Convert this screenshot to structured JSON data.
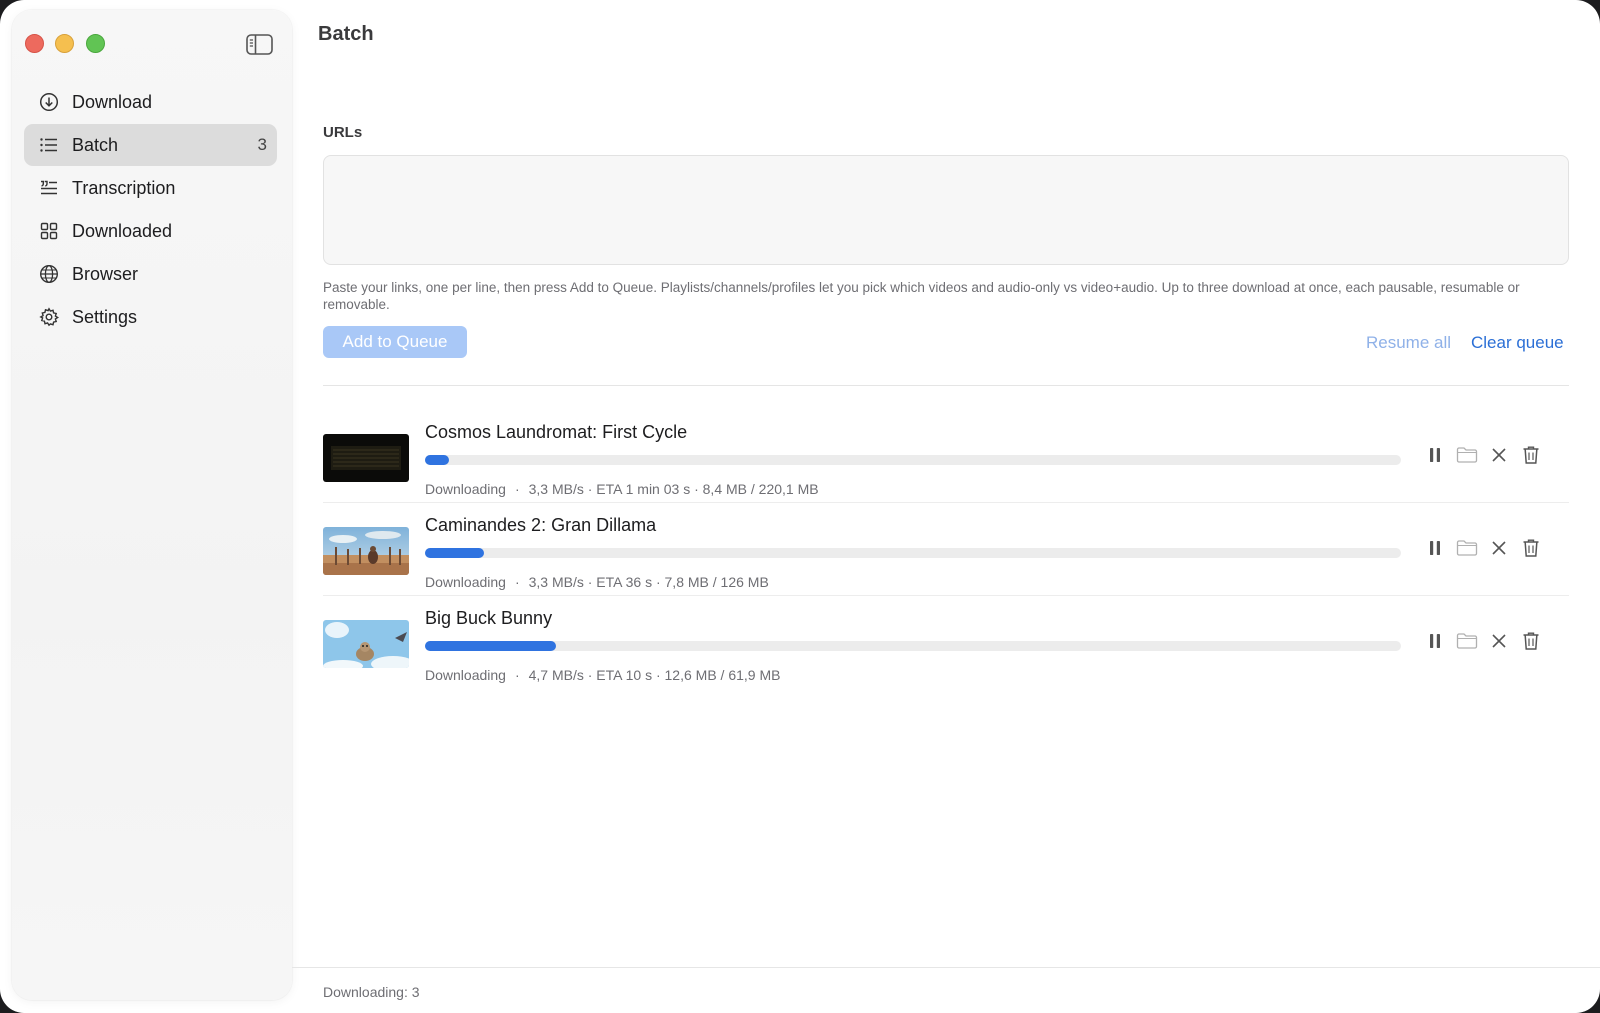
{
  "page": {
    "title": "Batch"
  },
  "sidebar": {
    "items": [
      {
        "label": "Download",
        "icon": "download-circle-icon"
      },
      {
        "label": "Batch",
        "icon": "list-icon",
        "badge": "3",
        "active": true
      },
      {
        "label": "Transcription",
        "icon": "transcription-icon"
      },
      {
        "label": "Downloaded",
        "icon": "grid-icon"
      },
      {
        "label": "Browser",
        "icon": "globe-icon"
      },
      {
        "label": "Settings",
        "icon": "gear-icon"
      }
    ]
  },
  "urls": {
    "label": "URLs",
    "value": "",
    "help": "Paste your links, one per line, then press Add to Queue. Playlists/channels/profiles let you pick which videos and audio-only vs video+audio. Up to three download at once, each pausable, resumable or removable."
  },
  "toolbar": {
    "add_label": "Add to Queue",
    "resume_all_label": "Resume all",
    "clear_queue_label": "Clear queue"
  },
  "queue": [
    {
      "title": "Cosmos Laundromat: First Cycle",
      "status": "Downloading",
      "details": "3,3 MB/s · ETA 1 min 03 s · 8,4 MB / 220,1 MB",
      "progress": 0.025
    },
    {
      "title": "Caminandes 2: Gran Dillama",
      "status": "Downloading",
      "details": "3,3 MB/s · ETA 36 s · 7,8 MB / 126 MB",
      "progress": 0.06
    },
    {
      "title": "Big Buck Bunny",
      "status": "Downloading",
      "details": "4,7 MB/s · ETA 10 s · 12,6 MB / 61,9 MB",
      "progress": 0.134
    }
  ],
  "footer": {
    "status": "Downloading: 3"
  },
  "colors": {
    "accent": "#2f73e0",
    "accent_disabled": "#a9c8f7",
    "sidebar_active": "#dcdcdc"
  }
}
